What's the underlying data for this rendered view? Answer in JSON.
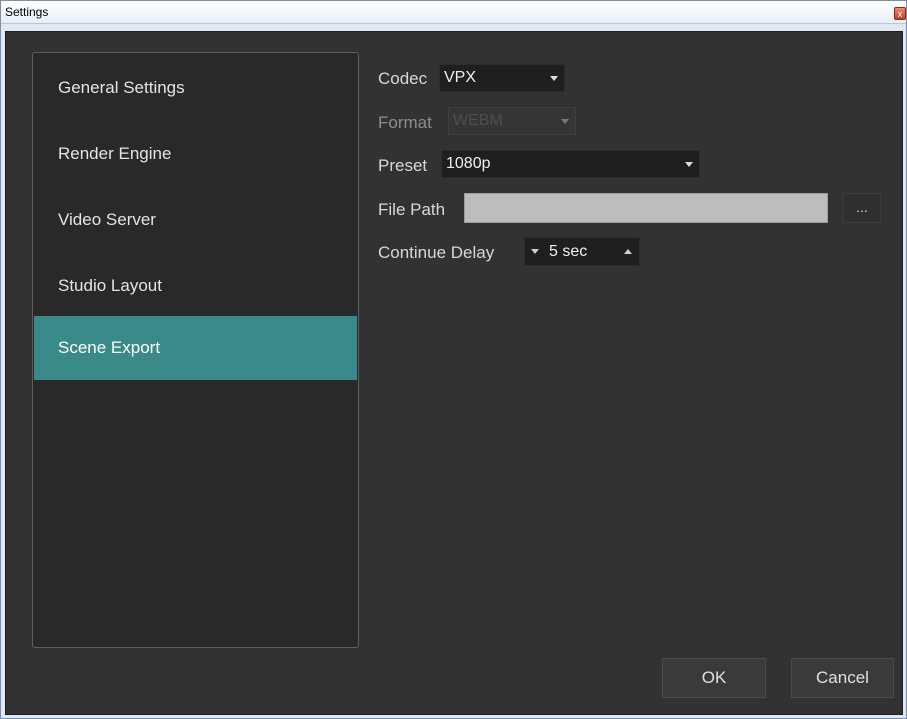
{
  "window": {
    "title": "Settings",
    "close_glyph": "x"
  },
  "nav": {
    "items": [
      {
        "label": "General Settings",
        "active": false
      },
      {
        "label": "Render Engine",
        "active": false
      },
      {
        "label": "Video Server",
        "active": false
      },
      {
        "label": "Studio Layout",
        "active": false
      },
      {
        "label": "Scene Export",
        "active": true
      }
    ],
    "active_color": "#3a8a89"
  },
  "form": {
    "codec": {
      "label": "Codec",
      "value": "VPX"
    },
    "format": {
      "label": "Format",
      "value": "WEBM",
      "enabled": false
    },
    "preset": {
      "label": "Preset",
      "value": "1080p"
    },
    "file_path": {
      "label": "File Path",
      "value": "",
      "browse_label": "..."
    },
    "continue_delay": {
      "label": "Continue Delay",
      "value": "5 sec"
    }
  },
  "buttons": {
    "ok": "OK",
    "cancel": "Cancel"
  }
}
